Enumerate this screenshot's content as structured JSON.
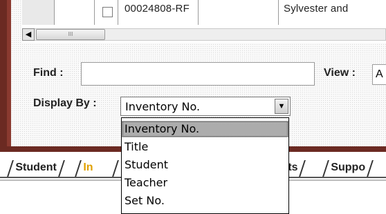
{
  "grid": {
    "row": {
      "inventory_no": "00024808-RF",
      "title": "Sylvester and"
    }
  },
  "scrollbar": {
    "left_arrow": "◀",
    "thumb_grip": "III"
  },
  "form": {
    "find_label": "Find :",
    "find_value": "",
    "view_label": "View :",
    "view_value": "A",
    "display_by_label": "Display By :",
    "display_by_selected": "Inventory No.",
    "display_by_button": "▼",
    "display_by_options": [
      "Inventory No.",
      "Title",
      "Student",
      "Teacher",
      "Set No."
    ]
  },
  "tabs": {
    "student": "Student",
    "inventory_partial": "In",
    "reports_partial": "orts",
    "support_partial": "Suppo"
  },
  "colors": {
    "frame": "#6b2a22",
    "active_tab_text": "#e0a000"
  }
}
